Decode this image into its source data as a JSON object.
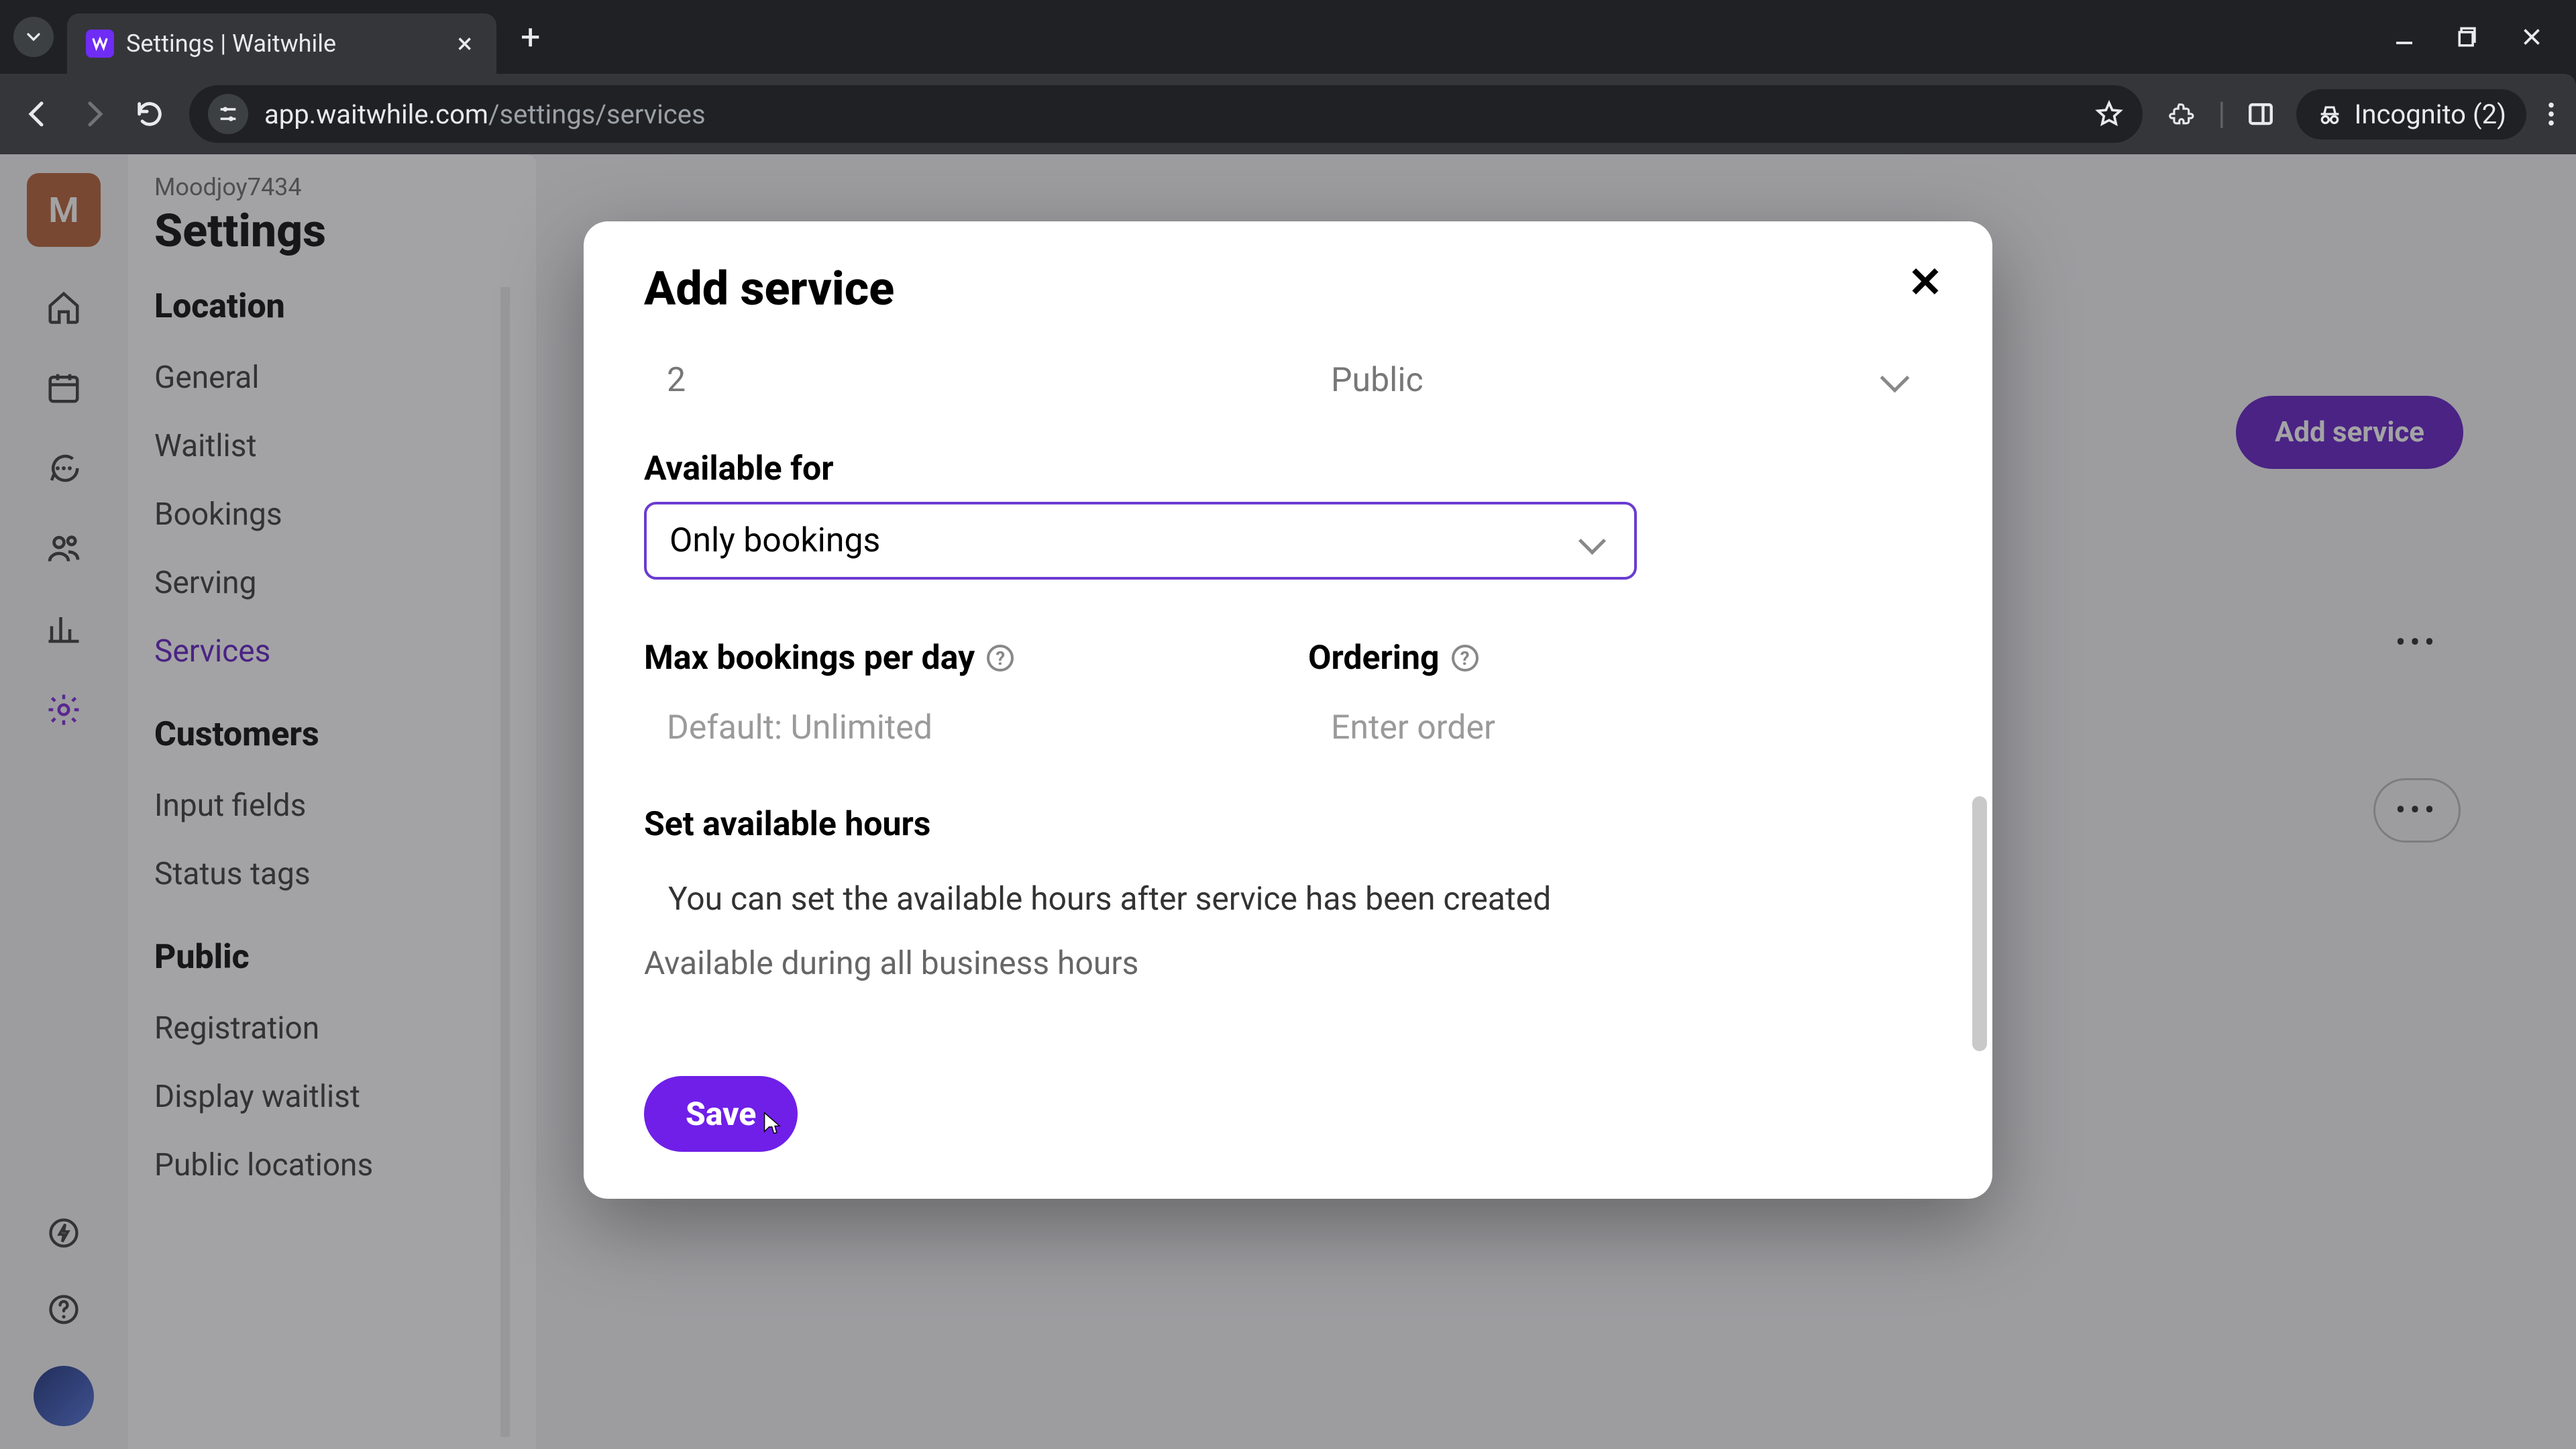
{
  "browser": {
    "tab_title": "Settings | Waitwhile",
    "url_host": "app.waitwhile.com",
    "url_path": "/settings/services",
    "incognito_label": "Incognito (2)"
  },
  "rail": {
    "avatar_letter": "M"
  },
  "sidebar": {
    "org": "Moodjoy7434",
    "title": "Settings",
    "sections": {
      "location": {
        "heading": "Location",
        "items": [
          "General",
          "Waitlist",
          "Bookings",
          "Serving",
          "Services"
        ]
      },
      "customers": {
        "heading": "Customers",
        "items": [
          "Input fields",
          "Status tags"
        ]
      },
      "public": {
        "heading": "Public",
        "items": [
          "Registration",
          "Display waitlist",
          "Public locations"
        ]
      }
    },
    "active_item": "Services"
  },
  "main": {
    "add_service_button": "Add service"
  },
  "modal": {
    "title": "Add service",
    "row_top": {
      "value_left": "2",
      "value_right": "Public"
    },
    "available_for": {
      "label": "Available for",
      "value": "Only bookings"
    },
    "max_bookings": {
      "label": "Max bookings per day",
      "placeholder": "Default: Unlimited"
    },
    "ordering": {
      "label": "Ordering",
      "placeholder": "Enter order"
    },
    "hours": {
      "heading": "Set available hours",
      "note": "You can set the available hours after service has been created",
      "sub": "Available during all business hours"
    },
    "save": "Save"
  },
  "colors": {
    "brand_purple": "#5d17c4",
    "accent_purple": "#6f1fe8"
  }
}
